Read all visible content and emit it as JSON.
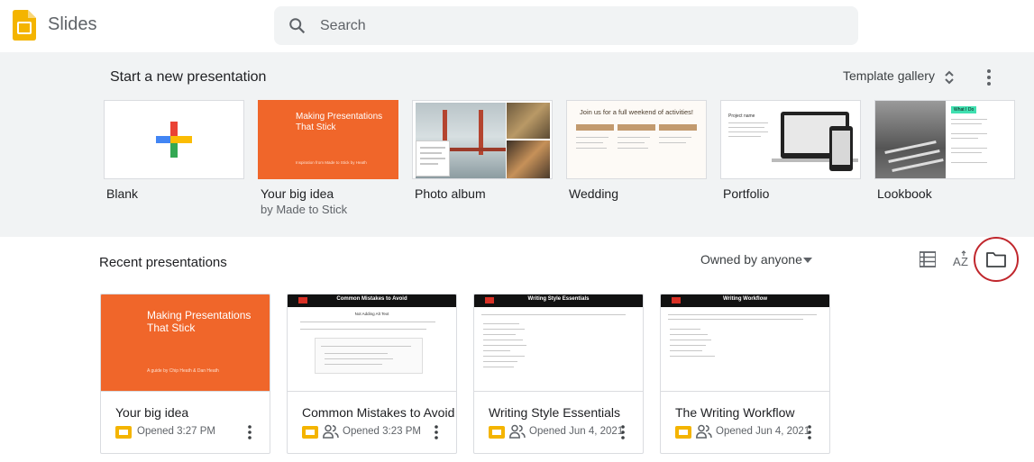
{
  "app": {
    "title": "Slides"
  },
  "search": {
    "placeholder": "Search"
  },
  "templates": {
    "heading": "Start a new presentation",
    "gallery_label": "Template gallery",
    "items": [
      {
        "label": "Blank",
        "sub": ""
      },
      {
        "label": "Your big idea",
        "sub": "by Made to Stick",
        "thumb_title": "Making Presentations That Stick",
        "thumb_caption": "Inspiration from Made to Stick by Heath"
      },
      {
        "label": "Photo album",
        "sub": ""
      },
      {
        "label": "Wedding",
        "sub": "",
        "thumb_title": "Join us for a full weekend of activities!"
      },
      {
        "label": "Portfolio",
        "sub": "",
        "thumb_title": "Project name"
      },
      {
        "label": "Lookbook",
        "sub": "",
        "thumb_title": "What I Do"
      }
    ]
  },
  "recent": {
    "heading": "Recent presentations",
    "owner_filter": "Owned by anyone",
    "cards": [
      {
        "title": "Your big idea",
        "meta": "Opened 3:27 PM",
        "shared": false,
        "thumb_title": "Making Presentations That Stick",
        "thumb_caption": "A guide by Chip Heath & Dan Heath"
      },
      {
        "title": "Common Mistakes to Avoid",
        "meta": "Opened 3:23 PM",
        "shared": true,
        "thumb_title": "Common Mistakes to Avoid",
        "thumb_sub": "Not Adding Alt Text"
      },
      {
        "title": "Writing Style Essentials",
        "meta": "Opened Jun 4, 2021",
        "shared": true,
        "thumb_title": "Writing Style Essentials",
        "thumb_sub": ""
      },
      {
        "title": "The Writing Workflow",
        "meta": "Opened Jun 4, 2021",
        "shared": true,
        "thumb_title": "Writing Workflow",
        "thumb_sub": ""
      }
    ]
  },
  "colors": {
    "accent_orange": "#f0662a",
    "slides_yellow": "#f4b400",
    "highlight_red": "#c0272d"
  },
  "icons": [
    "slides-logo-icon",
    "search-icon",
    "unfold-icon",
    "more-vert-icon",
    "dropdown-caret-icon",
    "list-view-icon",
    "sort-az-icon",
    "folder-icon",
    "slides-file-icon",
    "shared-people-icon"
  ]
}
